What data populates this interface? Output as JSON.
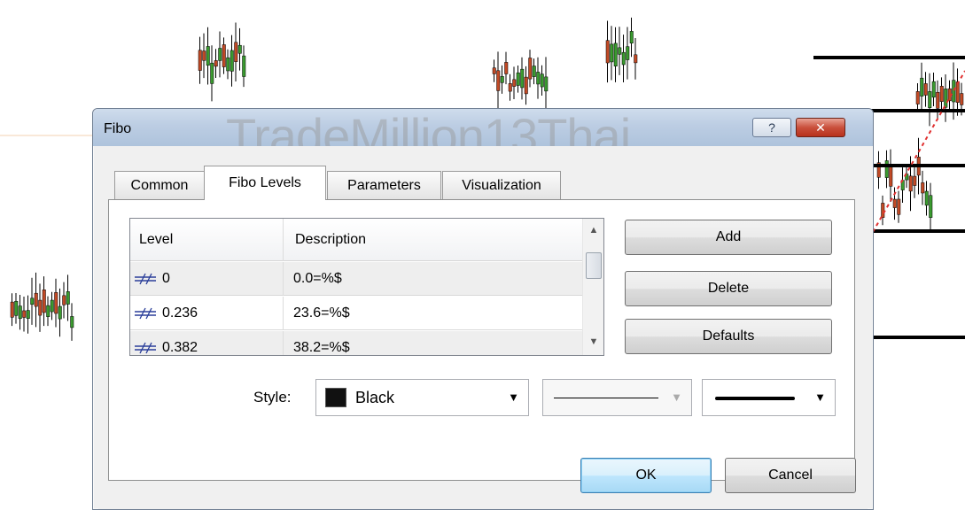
{
  "dialog": {
    "title": "Fibo",
    "watermark": "TradeMillion13Thai",
    "help_label": "?",
    "close_label": "✕"
  },
  "tabs": [
    {
      "label": "Common"
    },
    {
      "label": "Fibo Levels"
    },
    {
      "label": "Parameters"
    },
    {
      "label": "Visualization"
    }
  ],
  "levels_table": {
    "headers": [
      "Level",
      "Description"
    ],
    "rows": [
      {
        "level": "0",
        "description": "0.0=%$"
      },
      {
        "level": "0.236",
        "description": "23.6=%$"
      },
      {
        "level": "0.382",
        "description": "38.2=%$"
      }
    ]
  },
  "buttons": {
    "add": "Add",
    "delete": "Delete",
    "defaults": "Defaults",
    "ok": "OK",
    "cancel": "Cancel"
  },
  "style": {
    "label": "Style:",
    "color_name": "Black",
    "color_hex": "#111111"
  },
  "colors": {
    "bull_candle": "#3a9a2f",
    "bear_candle": "#c24a26",
    "chart_line": "#000000",
    "fib_dotted": "#e03030"
  }
}
